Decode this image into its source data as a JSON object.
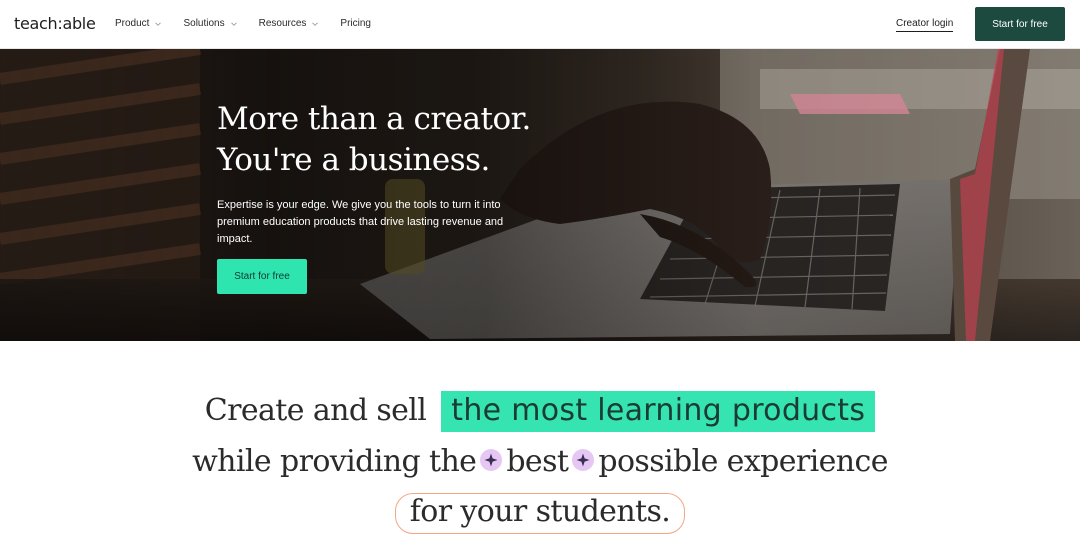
{
  "nav": {
    "logo": "teach:able",
    "items": [
      {
        "label": "Product",
        "has_dropdown": true
      },
      {
        "label": "Solutions",
        "has_dropdown": true
      },
      {
        "label": "Resources",
        "has_dropdown": true
      },
      {
        "label": "Pricing",
        "has_dropdown": false
      }
    ],
    "login_label": "Creator login",
    "cta_label": "Start for free"
  },
  "hero": {
    "title_line1": "More than a creator.",
    "title_line2": "You're a business.",
    "subtitle": "Expertise is your edge. We give you the tools to turn it into premium education products that drive lasting revenue and impact.",
    "cta_label": "Start for free"
  },
  "headline": {
    "line1_prefix": "Create and sell",
    "line1_highlight": "the most learning products",
    "line2_part1": "while providing the",
    "line2_part2": "best",
    "line2_part3": "possible experience",
    "line3": "for your students."
  },
  "colors": {
    "brand_dark": "#1c4a3e",
    "accent_mint": "#2ee5b0",
    "highlight_mint": "#36e4b2",
    "sparkle_lilac": "#e6c7f4",
    "outline_peach": "#f4a684"
  },
  "icons": {
    "dropdown": "chevron-down-icon",
    "sparkle": "sparkle-icon"
  }
}
